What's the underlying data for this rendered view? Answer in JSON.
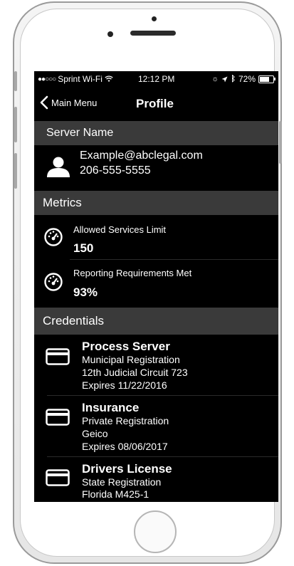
{
  "status_bar": {
    "carrier": "Sprint Wi-Fi",
    "time": "12:12 PM",
    "battery": "72%",
    "battery_level": 0.72
  },
  "nav": {
    "back_label": "Main Menu",
    "title": "Profile"
  },
  "server": {
    "header": "Server Name",
    "email": "Example@abclegal.com",
    "phone": "206-555-5555"
  },
  "metrics": {
    "header": "Metrics",
    "items": [
      {
        "label": "Allowed Services Limit",
        "value": "150"
      },
      {
        "label": "Reporting Requirements Met",
        "value": "93%"
      }
    ]
  },
  "credentials": {
    "header": "Credentials",
    "items": [
      {
        "title": "Process Server",
        "lines": [
          "Municipal Registration",
          "12th Judicial Circuit 723",
          "Expires 11/22/2016"
        ]
      },
      {
        "title": "Insurance",
        "lines": [
          "Private Registration",
          "Geico",
          "Expires 08/06/2017"
        ]
      },
      {
        "title": "Drivers License",
        "lines": [
          "State Registration",
          "Florida M425-1"
        ]
      }
    ]
  },
  "icons": {
    "back": "chevron-left-icon",
    "user": "user-icon",
    "metric": "speedometer-icon",
    "credential": "card-icon"
  }
}
